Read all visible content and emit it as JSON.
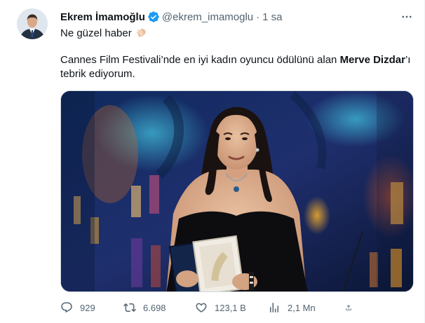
{
  "tweet": {
    "author_name": "Ekrem İmamoğlu",
    "handle": "@ekrem_imamoglu",
    "separator": "·",
    "time": "1 sa",
    "line1": "Ne güzel haber",
    "line1_emoji": "clapping-hands-emoji",
    "body_before": "Cannes Film Festivali’nde en iyi kadın oyuncu ödülünü alan ",
    "body_bold": "Merve Dizdar",
    "body_after": "’ı tebrik ediyorum.",
    "accent_color": "#1d9bf0",
    "media_description": "Woman in black strapless dress holding award box on stage"
  },
  "actions": {
    "replies": "929",
    "retweets": "6.698",
    "likes": "123,1 B",
    "views": "2,1 Mn"
  }
}
